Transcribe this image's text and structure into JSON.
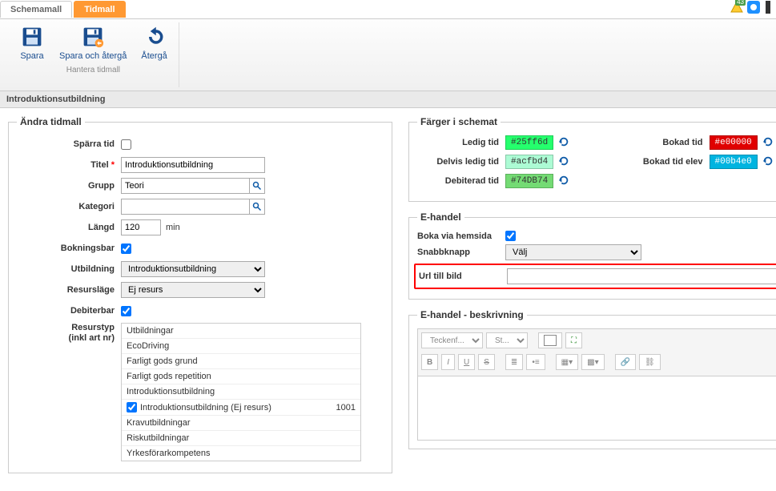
{
  "tabs": {
    "schemamall": "Schemamall",
    "tidmall": "Tidmall"
  },
  "notifications": {
    "count": "43"
  },
  "ribbon": {
    "spara": "Spara",
    "spara_aterga": "Spara och återgå",
    "aterga": "Återgå",
    "group_label": "Hantera tidmall"
  },
  "breadcrumb": "Introduktionsutbildning",
  "fieldsets": {
    "andra_tidmall": "Ändra tidmall",
    "farger": "Färger i schemat",
    "ehandel": "E-handel",
    "ehandel_beskr": "E-handel - beskrivning"
  },
  "form": {
    "sparra_label": "Spärra tid",
    "titel_label": "Titel",
    "titel_value": "Introduktionsutbildning",
    "grupp_label": "Grupp",
    "grupp_value": "Teori",
    "kategori_label": "Kategori",
    "kategori_value": "",
    "langd_label": "Längd",
    "langd_value": "120",
    "langd_unit": "min",
    "bokningsbar_label": "Bokningsbar",
    "utbildning_label": "Utbildning",
    "utbildning_value": "Introduktionsutbildning",
    "resurslage_label": "Resursläge",
    "resurslage_value": "Ej resurs",
    "debiterbar_label": "Debiterbar",
    "resurstyp_label1": "Resurstyp",
    "resurstyp_label2": "(inkl art nr)"
  },
  "resurs_items": [
    {
      "label": "Utbildningar",
      "checked": false,
      "art": ""
    },
    {
      "label": "EcoDriving",
      "checked": false,
      "art": ""
    },
    {
      "label": "Farligt gods grund",
      "checked": false,
      "art": ""
    },
    {
      "label": "Farligt gods repetition",
      "checked": false,
      "art": ""
    },
    {
      "label": "Introduktionsutbildning",
      "checked": false,
      "art": ""
    },
    {
      "label": "Introduktionsutbildning (Ej resurs)",
      "checked": true,
      "art": "1001"
    },
    {
      "label": "Kravutbildningar",
      "checked": false,
      "art": ""
    },
    {
      "label": "Riskutbildningar",
      "checked": false,
      "art": ""
    },
    {
      "label": "Yrkesförarkompetens",
      "checked": false,
      "art": ""
    }
  ],
  "colors": {
    "ledig_label": "Ledig tid",
    "ledig_value": "#25ff6d",
    "delvis_label": "Delvis ledig tid",
    "delvis_value": "#acfbd4",
    "debiterad_label": "Debiterad tid",
    "debiterad_value": "#74DB74",
    "bokad_label": "Bokad tid",
    "bokad_value": "#e00000",
    "bokad_elev_label": "Bokad tid elev",
    "bokad_elev_value": "#00b4e0"
  },
  "ehandel": {
    "boka_label": "Boka via hemsida",
    "snabb_label": "Snabbknapp",
    "snabb_value": "Välj",
    "url_label": "Url till bild",
    "url_value": ""
  },
  "editor": {
    "font_sel": "Teckenf...",
    "size_sel": "St..."
  }
}
